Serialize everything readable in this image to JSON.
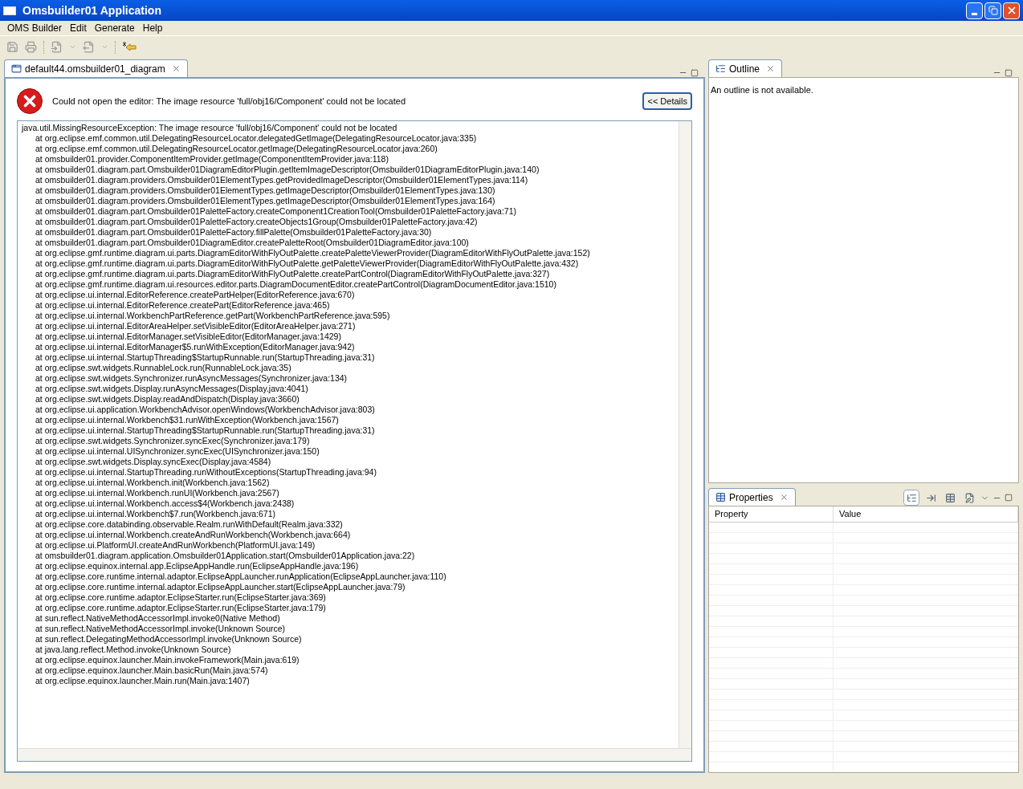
{
  "window": {
    "title": "Omsbuilder01 Application"
  },
  "menu": [
    "OMS Builder",
    "Edit",
    "Generate",
    "Help"
  ],
  "editor": {
    "tab": {
      "label": "default44.omsbuilder01_diagram",
      "selected": true
    },
    "error": {
      "message": "Could not open the editor: The image resource 'full/obj16/Component' could not be located",
      "details_button": "<< Details",
      "exception": "java.util.MissingResourceException: The image resource 'full/obj16/Component' could not be located",
      "frames": [
        "at org.eclipse.emf.common.util.DelegatingResourceLocator.delegatedGetImage(DelegatingResourceLocator.java:335)",
        "at org.eclipse.emf.common.util.DelegatingResourceLocator.getImage(DelegatingResourceLocator.java:260)",
        "at omsbuilder01.provider.ComponentItemProvider.getImage(ComponentItemProvider.java:118)",
        "at omsbuilder01.diagram.part.Omsbuilder01DiagramEditorPlugin.getItemImageDescriptor(Omsbuilder01DiagramEditorPlugin.java:140)",
        "at omsbuilder01.diagram.providers.Omsbuilder01ElementTypes.getProvidedImageDescriptor(Omsbuilder01ElementTypes.java:114)",
        "at omsbuilder01.diagram.providers.Omsbuilder01ElementTypes.getImageDescriptor(Omsbuilder01ElementTypes.java:130)",
        "at omsbuilder01.diagram.providers.Omsbuilder01ElementTypes.getImageDescriptor(Omsbuilder01ElementTypes.java:164)",
        "at omsbuilder01.diagram.part.Omsbuilder01PaletteFactory.createComponent1CreationTool(Omsbuilder01PaletteFactory.java:71)",
        "at omsbuilder01.diagram.part.Omsbuilder01PaletteFactory.createObjects1Group(Omsbuilder01PaletteFactory.java:42)",
        "at omsbuilder01.diagram.part.Omsbuilder01PaletteFactory.fillPalette(Omsbuilder01PaletteFactory.java:30)",
        "at omsbuilder01.diagram.part.Omsbuilder01DiagramEditor.createPaletteRoot(Omsbuilder01DiagramEditor.java:100)",
        "at org.eclipse.gmf.runtime.diagram.ui.parts.DiagramEditorWithFlyOutPalette.createPaletteViewerProvider(DiagramEditorWithFlyOutPalette.java:152)",
        "at org.eclipse.gmf.runtime.diagram.ui.parts.DiagramEditorWithFlyOutPalette.getPaletteViewerProvider(DiagramEditorWithFlyOutPalette.java:432)",
        "at org.eclipse.gmf.runtime.diagram.ui.parts.DiagramEditorWithFlyOutPalette.createPartControl(DiagramEditorWithFlyOutPalette.java:327)",
        "at org.eclipse.gmf.runtime.diagram.ui.resources.editor.parts.DiagramDocumentEditor.createPartControl(DiagramDocumentEditor.java:1510)",
        "at org.eclipse.ui.internal.EditorReference.createPartHelper(EditorReference.java:670)",
        "at org.eclipse.ui.internal.EditorReference.createPart(EditorReference.java:465)",
        "at org.eclipse.ui.internal.WorkbenchPartReference.getPart(WorkbenchPartReference.java:595)",
        "at org.eclipse.ui.internal.EditorAreaHelper.setVisibleEditor(EditorAreaHelper.java:271)",
        "at org.eclipse.ui.internal.EditorManager.setVisibleEditor(EditorManager.java:1429)",
        "at org.eclipse.ui.internal.EditorManager$5.runWithException(EditorManager.java:942)",
        "at org.eclipse.ui.internal.StartupThreading$StartupRunnable.run(StartupThreading.java:31)",
        "at org.eclipse.swt.widgets.RunnableLock.run(RunnableLock.java:35)",
        "at org.eclipse.swt.widgets.Synchronizer.runAsyncMessages(Synchronizer.java:134)",
        "at org.eclipse.swt.widgets.Display.runAsyncMessages(Display.java:4041)",
        "at org.eclipse.swt.widgets.Display.readAndDispatch(Display.java:3660)",
        "at org.eclipse.ui.application.WorkbenchAdvisor.openWindows(WorkbenchAdvisor.java:803)",
        "at org.eclipse.ui.internal.Workbench$31.runWithException(Workbench.java:1567)",
        "at org.eclipse.ui.internal.StartupThreading$StartupRunnable.run(StartupThreading.java:31)",
        "at org.eclipse.swt.widgets.Synchronizer.syncExec(Synchronizer.java:179)",
        "at org.eclipse.ui.internal.UISynchronizer.syncExec(UISynchronizer.java:150)",
        "at org.eclipse.swt.widgets.Display.syncExec(Display.java:4584)",
        "at org.eclipse.ui.internal.StartupThreading.runWithoutExceptions(StartupThreading.java:94)",
        "at org.eclipse.ui.internal.Workbench.init(Workbench.java:1562)",
        "at org.eclipse.ui.internal.Workbench.runUI(Workbench.java:2567)",
        "at org.eclipse.ui.internal.Workbench.access$4(Workbench.java:2438)",
        "at org.eclipse.ui.internal.Workbench$7.run(Workbench.java:671)",
        "at org.eclipse.core.databinding.observable.Realm.runWithDefault(Realm.java:332)",
        "at org.eclipse.ui.internal.Workbench.createAndRunWorkbench(Workbench.java:664)",
        "at org.eclipse.ui.PlatformUI.createAndRunWorkbench(PlatformUI.java:149)",
        "at omsbuilder01.diagram.application.Omsbuilder01Application.start(Omsbuilder01Application.java:22)",
        "at org.eclipse.equinox.internal.app.EclipseAppHandle.run(EclipseAppHandle.java:196)",
        "at org.eclipse.core.runtime.internal.adaptor.EclipseAppLauncher.runApplication(EclipseAppLauncher.java:110)",
        "at org.eclipse.core.runtime.internal.adaptor.EclipseAppLauncher.start(EclipseAppLauncher.java:79)",
        "at org.eclipse.core.runtime.adaptor.EclipseStarter.run(EclipseStarter.java:369)",
        "at org.eclipse.core.runtime.adaptor.EclipseStarter.run(EclipseStarter.java:179)",
        "at sun.reflect.NativeMethodAccessorImpl.invoke0(Native Method)",
        "at sun.reflect.NativeMethodAccessorImpl.invoke(Unknown Source)",
        "at sun.reflect.DelegatingMethodAccessorImpl.invoke(Unknown Source)",
        "at java.lang.reflect.Method.invoke(Unknown Source)",
        "at org.eclipse.equinox.launcher.Main.invokeFramework(Main.java:619)",
        "at org.eclipse.equinox.launcher.Main.basicRun(Main.java:574)",
        "at org.eclipse.equinox.launcher.Main.run(Main.java:1407)"
      ]
    }
  },
  "outline": {
    "tab": {
      "label": "Outline",
      "selected": true
    },
    "message": "An outline is not available."
  },
  "properties": {
    "tab": {
      "label": "Properties",
      "selected": true
    },
    "tool_buttons": [
      {
        "selected": true
      },
      {
        "selected": false
      },
      {
        "selected": false
      },
      {
        "selected": false
      }
    ],
    "columns": [
      "Property",
      "Value"
    ]
  }
}
